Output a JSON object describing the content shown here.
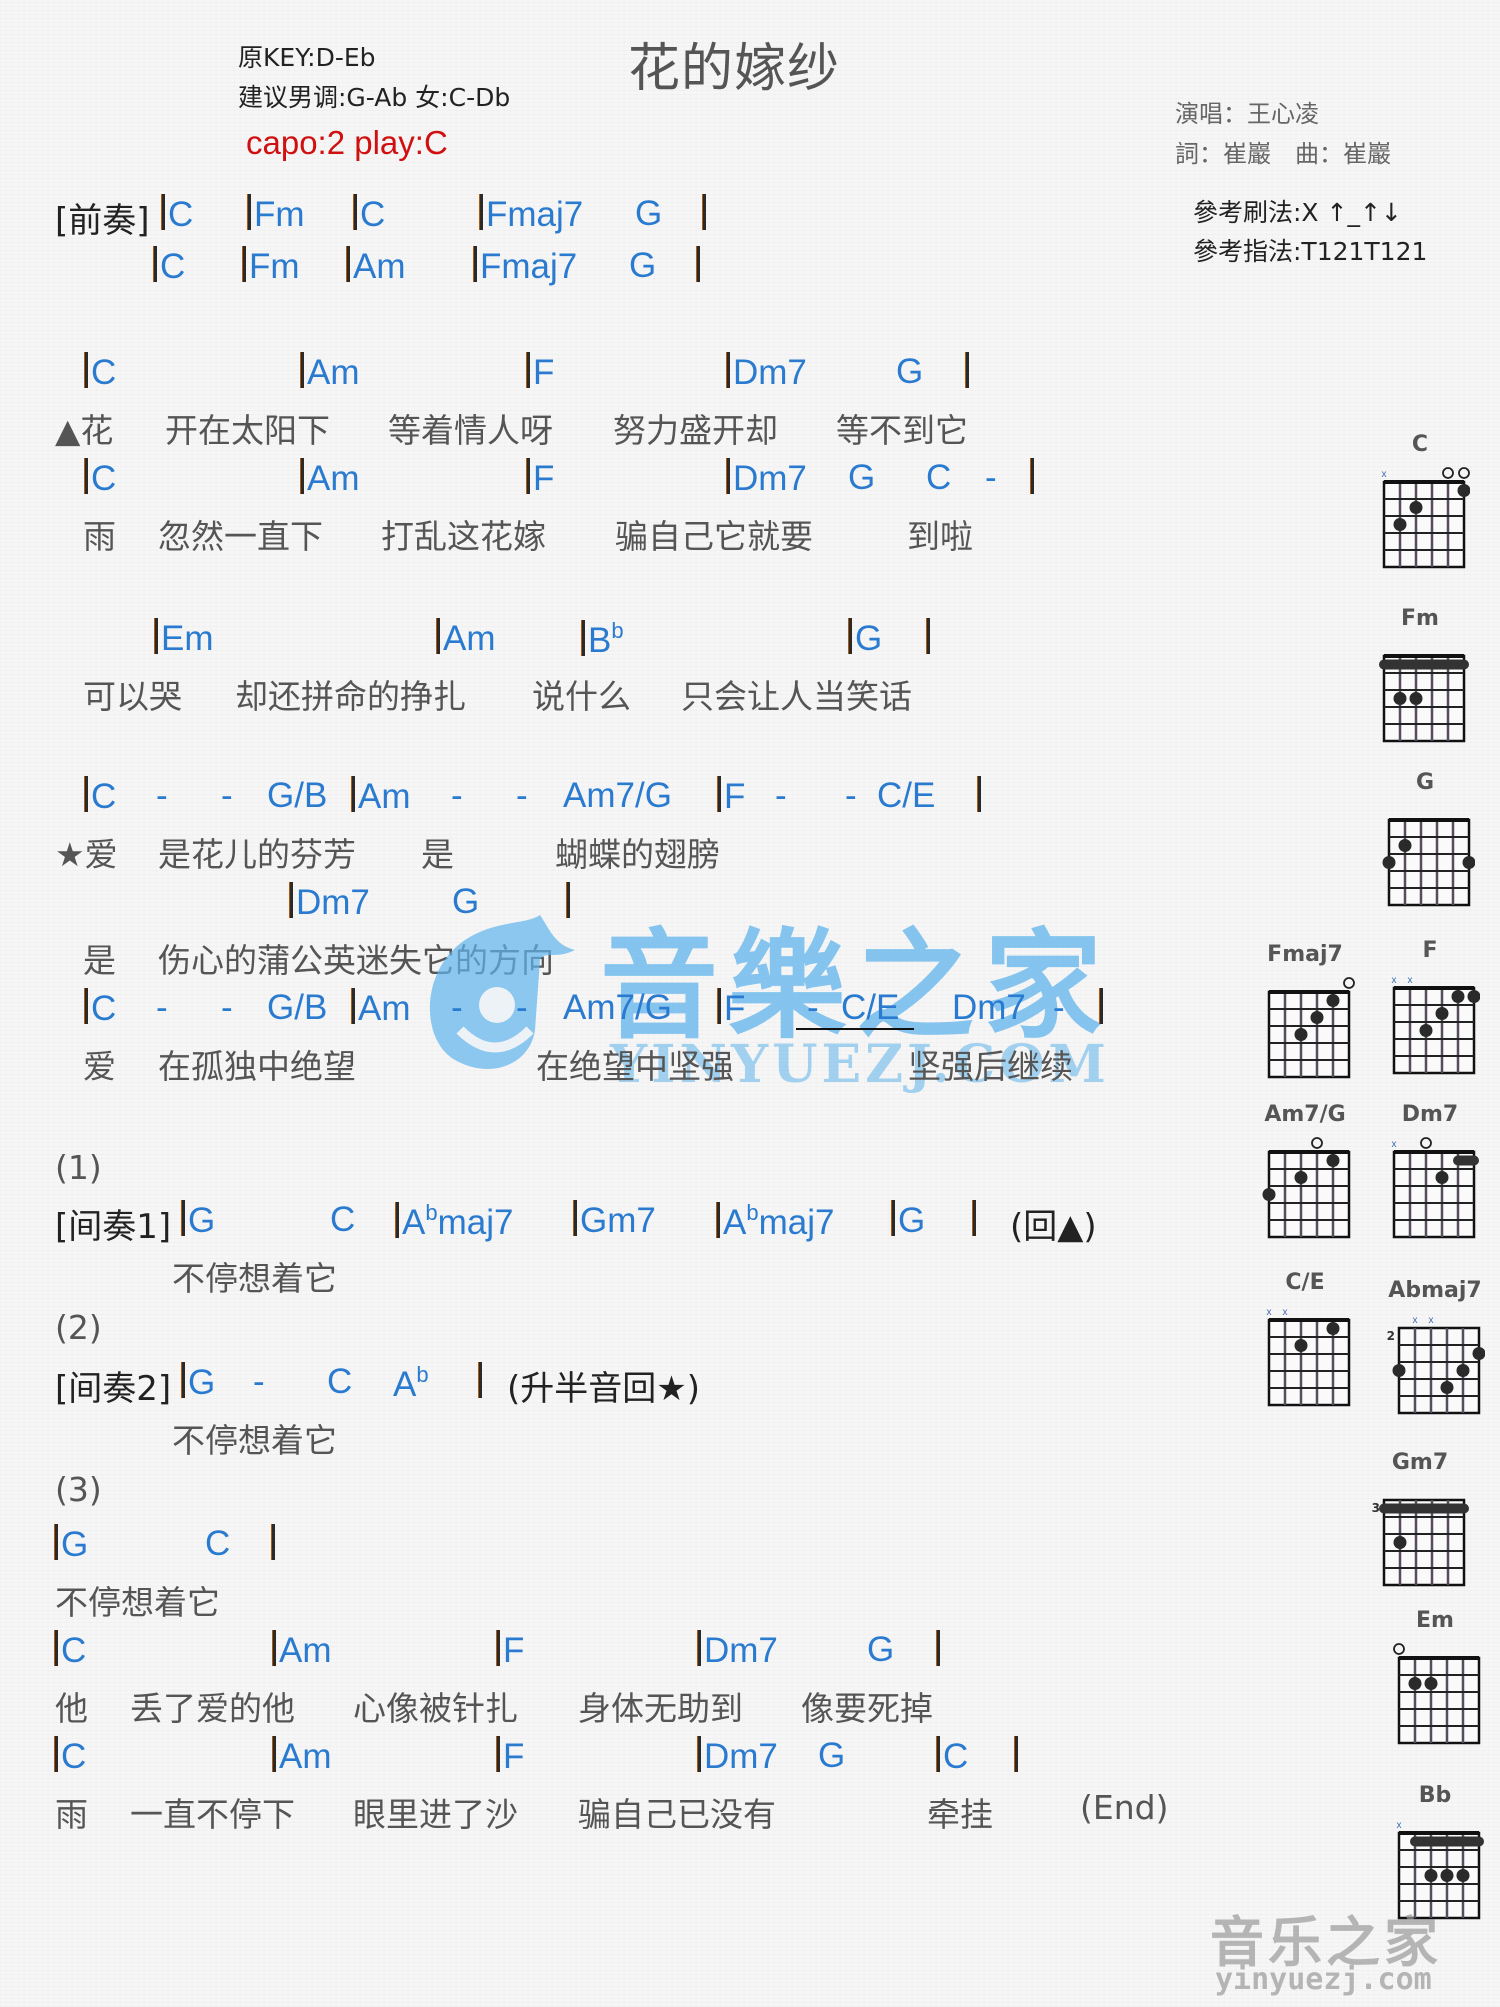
{
  "header": {
    "title": "花的嫁纱",
    "original_key": "原KEY:D-Eb",
    "suggested_key": "建议男调:G-Ab 女:C-Db",
    "capo": "capo:2 play:C",
    "singer": "演唱：王心凌",
    "credits": "詞：崔巖　曲：崔巖",
    "strum": "參考刷法:X ↑_↑↓",
    "pick": "參考指法:T121T121"
  },
  "lines": {
    "intro_label": "[前奏]",
    "intro1": [
      "C",
      "Fm",
      "C",
      "Fmaj7",
      "G"
    ],
    "intro2": [
      "C",
      "Fm",
      "Am",
      "Fmaj7",
      "G"
    ],
    "v1_chords": [
      "C",
      "Am",
      "F",
      "Dm7",
      "G"
    ],
    "v1_lyrics": [
      "▲花",
      "开在太阳下",
      "等着情人呀",
      "努力盛开却",
      "等不到它"
    ],
    "v2_chords": [
      "C",
      "Am",
      "F",
      "Dm7",
      "G",
      "C",
      "-"
    ],
    "v2_lyrics": [
      "雨",
      "忽然一直下",
      "打乱这花嫁",
      "骗自己它就要",
      "到啦"
    ],
    "v3_chords": [
      "Em",
      "Am",
      "B",
      "b",
      "G"
    ],
    "v3_lyrics": [
      "可以哭",
      "却还拼命的挣扎",
      "说什么",
      "只会让人当笑话"
    ],
    "c1_chords": [
      "C",
      "-",
      "-",
      "G/B",
      "Am",
      "-",
      "-",
      "Am7/G",
      "F",
      "-",
      "-",
      "C/E"
    ],
    "c1_lyrics": [
      "★爱",
      "是花儿的芬芳",
      "是",
      "蝴蝶的翅膀"
    ],
    "c2_chords": [
      "Dm7",
      "G"
    ],
    "c2_lyrics": [
      "是",
      "伤心的蒲公英迷失它的方向"
    ],
    "c3_chords": [
      "C",
      "-",
      "-",
      "G/B",
      "Am",
      "-",
      "-",
      "Am7/G",
      "F",
      "-",
      "C/E",
      "Dm7",
      "-"
    ],
    "c3_lyrics": [
      "爱",
      "在孤独中绝望",
      "在绝望中坚强",
      "坚强后继续"
    ],
    "p1": "(1)",
    "inter1_label": "[间奏1]",
    "inter1": [
      "G",
      "C",
      "A",
      "b",
      "maj7",
      "Gm7",
      "A",
      "b",
      "maj7",
      "G"
    ],
    "inter1_note": "(回▲)",
    "inter1_lyric": "不停想着它",
    "p2": "(2)",
    "inter2_label": "[间奏2]",
    "inter2": [
      "G",
      "-",
      "C",
      "A",
      "b"
    ],
    "inter2_note": "(升半音回★)",
    "inter2_lyric": "不停想着它",
    "p3": "(3)",
    "o1_chords": [
      "G",
      "C"
    ],
    "o1_lyric": "不停想着它",
    "o2_chords": [
      "C",
      "Am",
      "F",
      "Dm7",
      "G"
    ],
    "o2_lyrics": [
      "他",
      "丢了爱的他",
      "心像被针扎",
      "身体无助到",
      "像要死掉"
    ],
    "o3_chords": [
      "C",
      "Am",
      "F",
      "Dm7",
      "G",
      "C"
    ],
    "o3_lyrics": [
      "雨",
      "一直不停下",
      "眼里进了沙",
      "骗自己已没有",
      "牵挂",
      "(End)"
    ]
  },
  "watermark": {
    "main": "音樂之家",
    "sub": "YINYUEZJ.COM",
    "bottom_main": "音乐之家",
    "bottom_sub": "yinyuezj.com"
  },
  "diagrams": [
    {
      "name": "C",
      "base_fret": null,
      "markers": [
        "x",
        "",
        "",
        "",
        "o",
        "o"
      ],
      "dots": [
        [
          5,
          1
        ],
        [
          2,
          2
        ],
        [
          1,
          3
        ]
      ],
      "barre": null
    },
    {
      "name": "Fm",
      "base_fret": null,
      "markers": [
        "",
        "",
        "",
        "",
        "",
        ""
      ],
      "dots": [
        [
          1,
          3
        ],
        [
          2,
          3
        ]
      ],
      "barre": [
        0,
        5,
        1
      ]
    },
    {
      "name": "G",
      "base_fret": null,
      "markers": [
        "",
        "",
        "",
        "",
        "",
        ""
      ],
      "dots": [
        [
          1,
          2
        ],
        [
          0,
          3
        ],
        [
          5,
          3
        ]
      ],
      "barre": null
    },
    {
      "name": "Fmaj7",
      "base_fret": null,
      "markers": [
        "",
        "",
        "",
        "",
        "",
        "o"
      ],
      "dots": [
        [
          4,
          1
        ],
        [
          3,
          2
        ],
        [
          2,
          3
        ]
      ],
      "barre": null
    },
    {
      "name": "F",
      "base_fret": null,
      "markers": [
        "x",
        "x",
        "",
        "",
        "",
        ""
      ],
      "dots": [
        [
          4,
          1
        ],
        [
          5,
          1
        ],
        [
          3,
          2
        ],
        [
          2,
          3
        ]
      ],
      "barre": null
    },
    {
      "name": "Am7/G",
      "base_fret": null,
      "markers": [
        "",
        "",
        "",
        "o",
        "",
        ""
      ],
      "dots": [
        [
          4,
          1
        ],
        [
          2,
          2
        ],
        [
          0,
          3
        ]
      ],
      "barre": null
    },
    {
      "name": "Dm7",
      "base_fret": null,
      "markers": [
        "x",
        "",
        "o",
        "",
        "",
        ""
      ],
      "dots": [
        [
          3,
          2
        ]
      ],
      "barre": [
        4,
        5,
        1
      ]
    },
    {
      "name": "C/E",
      "base_fret": null,
      "markers": [
        "x",
        "x",
        "",
        "",
        "",
        ""
      ],
      "dots": [
        [
          4,
          1
        ],
        [
          2,
          2
        ]
      ],
      "barre": null
    },
    {
      "name": "Abmaj7",
      "base_fret": "2",
      "markers": [
        "",
        "x",
        "x",
        "",
        "",
        ""
      ],
      "dots": [
        [
          5,
          2
        ],
        [
          0,
          3
        ],
        [
          4,
          3
        ],
        [
          3,
          4
        ]
      ],
      "barre": null
    },
    {
      "name": "Gm7",
      "base_fret": "3",
      "markers": [
        "",
        "",
        "",
        "",
        "",
        ""
      ],
      "dots": [
        [
          1,
          3
        ]
      ],
      "barre": [
        0,
        5,
        1
      ]
    },
    {
      "name": "Em",
      "base_fret": null,
      "markers": [
        "o",
        "",
        "",
        "",
        "",
        ""
      ],
      "dots": [
        [
          1,
          2
        ],
        [
          2,
          2
        ]
      ],
      "barre": null
    },
    {
      "name": "Bb",
      "base_fret": null,
      "markers": [
        "x",
        "",
        "",
        "",
        "",
        ""
      ],
      "dots": [
        [
          2,
          3
        ],
        [
          3,
          3
        ],
        [
          4,
          3
        ]
      ],
      "barre": [
        1,
        5,
        1
      ]
    }
  ]
}
